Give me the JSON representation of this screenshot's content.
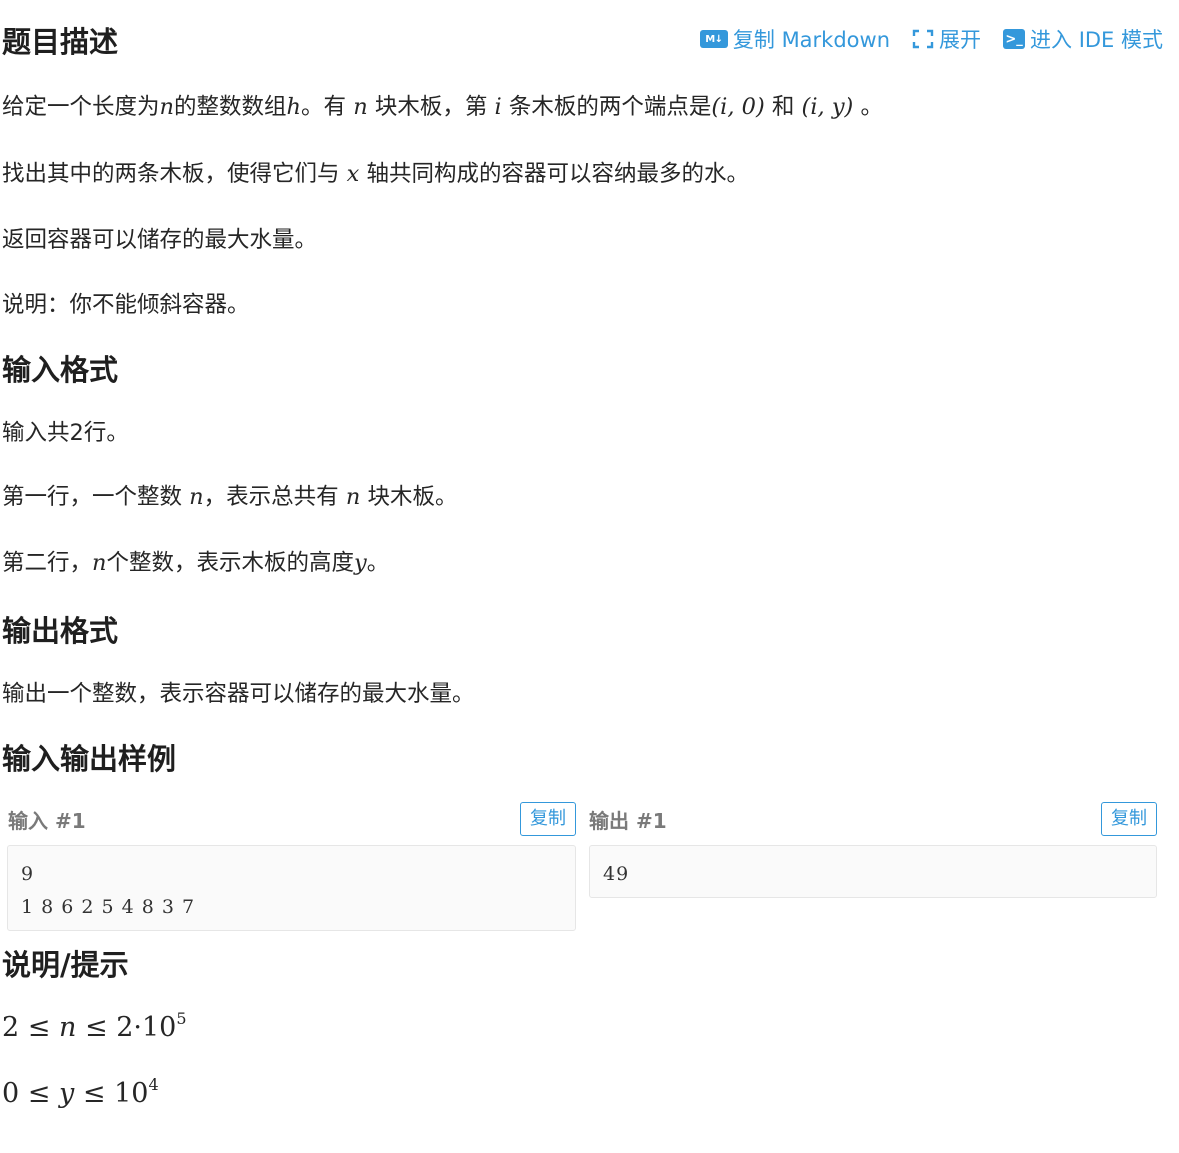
{
  "toolbar": {
    "copy_markdown_icon": "M↓",
    "copy_markdown_label": "复制 Markdown",
    "expand_label": "展开",
    "ide_icon": ">_",
    "ide_label": "进入 IDE 模式"
  },
  "sections": {
    "description": {
      "heading": "题目描述",
      "p1_a": "给定一个长度为",
      "p1_n": "n",
      "p1_b": "的整数数组",
      "p1_h": "h",
      "p1_c": "。有 ",
      "p1_n2": "n",
      "p1_d": " 块木板，第 ",
      "p1_i": "i",
      "p1_e": " 条木板的两个端点是",
      "p1_pt1": "(i, 0)",
      "p1_f": " 和 ",
      "p1_pt2": "(i, y)",
      "p1_g": " 。",
      "p2_a": "找出其中的两条木板，使得它们与 ",
      "p2_x": "x",
      "p2_b": " 轴共同构成的容器可以容纳最多的水。",
      "p3": "返回容器可以储存的最大水量。",
      "p4": "说明：你不能倾斜容器。"
    },
    "input_format": {
      "heading": "输入格式",
      "p1": "输入共2行。",
      "p2_a": "第一行，一个整数 ",
      "p2_n": "n",
      "p2_b": "，表示总共有 ",
      "p2_n2": "n",
      "p2_c": " 块木板。",
      "p3_a": "第二行，",
      "p3_n": "n",
      "p3_b": "个整数，表示木板的高度",
      "p3_y": "y",
      "p3_c": "。"
    },
    "output_format": {
      "heading": "输出格式",
      "p1": "输出一个整数，表示容器可以储存的最大水量。"
    },
    "samples": {
      "heading": "输入输出样例",
      "input_title": "输入 #1",
      "output_title": "输出 #1",
      "copy_label": "复制",
      "input_text": "9\n1 8 6 2 5 4 8 3 7",
      "output_text": "49"
    },
    "hint": {
      "heading": "说明/提示",
      "c1_a": "2",
      "c1_le1": "≤",
      "c1_n": "n",
      "c1_le2": "≤",
      "c1_b": "2·10",
      "c1_exp": "5",
      "c2_a": "0",
      "c2_le1": "≤",
      "c2_y": "y",
      "c2_le2": "≤",
      "c2_b": "10",
      "c2_exp": "4"
    }
  }
}
